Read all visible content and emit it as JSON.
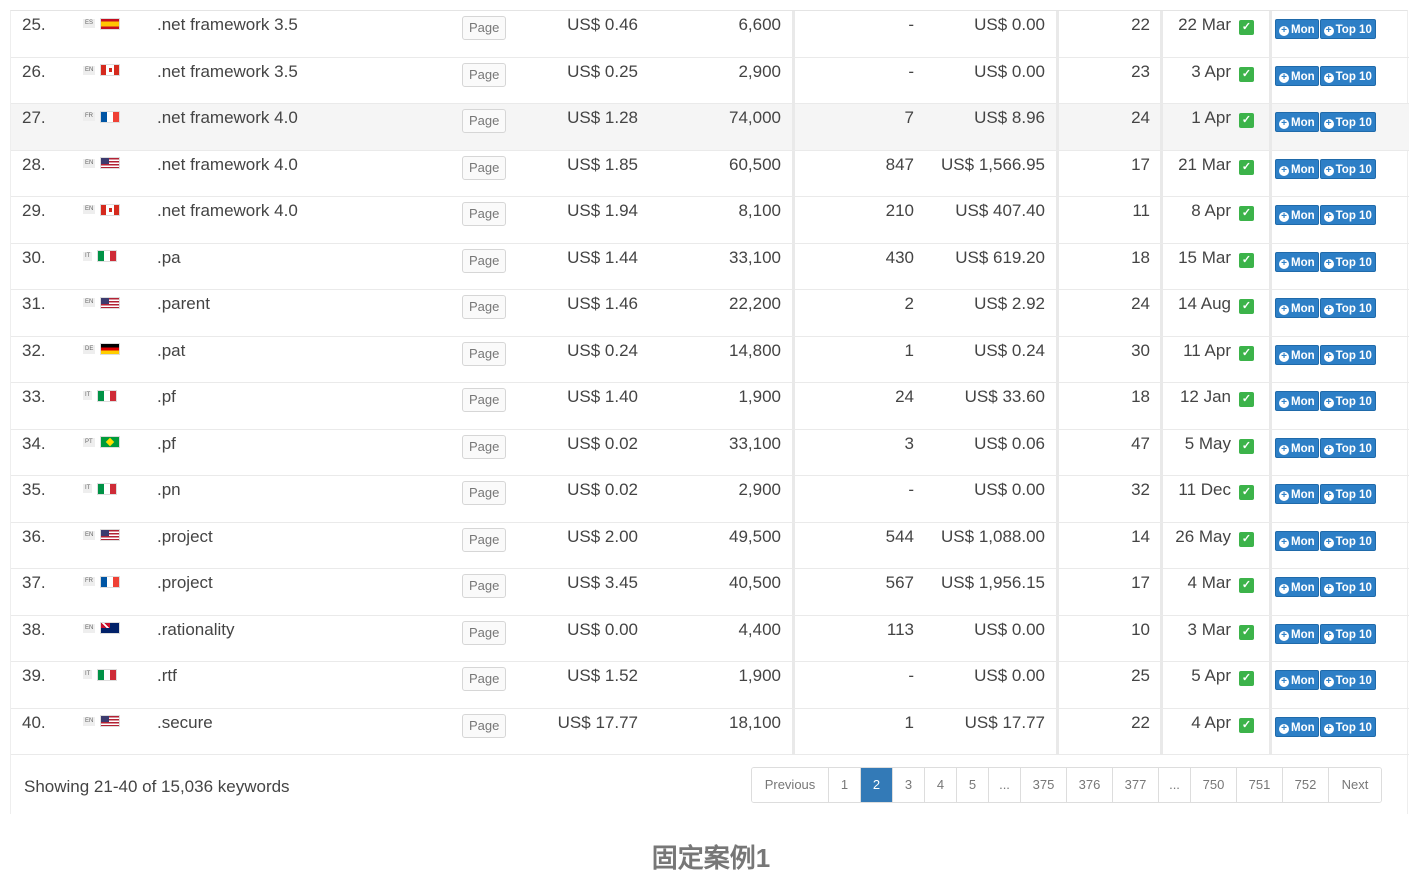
{
  "rows": [
    {
      "num": "25.",
      "lang": "ES",
      "flag": "es",
      "keyword": ".net framework 3.5",
      "type": "Page",
      "cpc": "US$ 0.46",
      "volume": "6,600",
      "clicks": "-",
      "value": "US$ 0.00",
      "comp": "22",
      "date": "22 Mar"
    },
    {
      "num": "26.",
      "lang": "EN",
      "flag": "ca",
      "keyword": ".net framework 3.5",
      "type": "Page",
      "cpc": "US$ 0.25",
      "volume": "2,900",
      "clicks": "-",
      "value": "US$ 0.00",
      "comp": "23",
      "date": "3 Apr"
    },
    {
      "num": "27.",
      "lang": "FR",
      "flag": "fr",
      "keyword": ".net framework 4.0",
      "type": "Page",
      "cpc": "US$ 1.28",
      "volume": "74,000",
      "clicks": "7",
      "value": "US$ 8.96",
      "comp": "24",
      "date": "1 Apr"
    },
    {
      "num": "28.",
      "lang": "EN",
      "flag": "us",
      "keyword": ".net framework 4.0",
      "type": "Page",
      "cpc": "US$ 1.85",
      "volume": "60,500",
      "clicks": "847",
      "value": "US$ 1,566.95",
      "comp": "17",
      "date": "21 Mar"
    },
    {
      "num": "29.",
      "lang": "EN",
      "flag": "ca",
      "keyword": ".net framework 4.0",
      "type": "Page",
      "cpc": "US$ 1.94",
      "volume": "8,100",
      "clicks": "210",
      "value": "US$ 407.40",
      "comp": "11",
      "date": "8 Apr"
    },
    {
      "num": "30.",
      "lang": "IT",
      "flag": "it",
      "keyword": ".pa",
      "type": "Page",
      "cpc": "US$ 1.44",
      "volume": "33,100",
      "clicks": "430",
      "value": "US$ 619.20",
      "comp": "18",
      "date": "15 Mar"
    },
    {
      "num": "31.",
      "lang": "EN",
      "flag": "us",
      "keyword": ".parent",
      "type": "Page",
      "cpc": "US$ 1.46",
      "volume": "22,200",
      "clicks": "2",
      "value": "US$ 2.92",
      "comp": "24",
      "date": "14 Aug"
    },
    {
      "num": "32.",
      "lang": "DE",
      "flag": "de",
      "keyword": ".pat",
      "type": "Page",
      "cpc": "US$ 0.24",
      "volume": "14,800",
      "clicks": "1",
      "value": "US$ 0.24",
      "comp": "30",
      "date": "11 Apr"
    },
    {
      "num": "33.",
      "lang": "IT",
      "flag": "it",
      "keyword": ".pf",
      "type": "Page",
      "cpc": "US$ 1.40",
      "volume": "1,900",
      "clicks": "24",
      "value": "US$ 33.60",
      "comp": "18",
      "date": "12 Jan"
    },
    {
      "num": "34.",
      "lang": "PT",
      "flag": "br",
      "keyword": ".pf",
      "type": "Page",
      "cpc": "US$ 0.02",
      "volume": "33,100",
      "clicks": "3",
      "value": "US$ 0.06",
      "comp": "47",
      "date": "5 May"
    },
    {
      "num": "35.",
      "lang": "IT",
      "flag": "it",
      "keyword": ".pn",
      "type": "Page",
      "cpc": "US$ 0.02",
      "volume": "2,900",
      "clicks": "-",
      "value": "US$ 0.00",
      "comp": "32",
      "date": "11 Dec"
    },
    {
      "num": "36.",
      "lang": "EN",
      "flag": "us",
      "keyword": ".project",
      "type": "Page",
      "cpc": "US$ 2.00",
      "volume": "49,500",
      "clicks": "544",
      "value": "US$ 1,088.00",
      "comp": "14",
      "date": "26 May"
    },
    {
      "num": "37.",
      "lang": "FR",
      "flag": "fr",
      "keyword": ".project",
      "type": "Page",
      "cpc": "US$ 3.45",
      "volume": "40,500",
      "clicks": "567",
      "value": "US$ 1,956.15",
      "comp": "17",
      "date": "4 Mar"
    },
    {
      "num": "38.",
      "lang": "EN",
      "flag": "au",
      "keyword": ".rationality",
      "type": "Page",
      "cpc": "US$ 0.00",
      "volume": "4,400",
      "clicks": "113",
      "value": "US$ 0.00",
      "comp": "10",
      "date": "3 Mar"
    },
    {
      "num": "39.",
      "lang": "IT",
      "flag": "it",
      "keyword": ".rtf",
      "type": "Page",
      "cpc": "US$ 1.52",
      "volume": "1,900",
      "clicks": "-",
      "value": "US$ 0.00",
      "comp": "25",
      "date": "5 Apr"
    },
    {
      "num": "40.",
      "lang": "EN",
      "flag": "us",
      "keyword": ".secure",
      "type": "Page",
      "cpc": "US$ 17.77",
      "volume": "18,100",
      "clicks": "1",
      "value": "US$ 17.77",
      "comp": "22",
      "date": "4 Apr"
    }
  ],
  "highlight_row_index": 2,
  "buttons": {
    "mon_label": "Mon",
    "top10_label": "Top 10",
    "plus_glyph": "+",
    "check_glyph": "✓"
  },
  "footer": {
    "showing": "Showing 21-40 of 15,036 keywords"
  },
  "pagination": {
    "items": [
      "Previous",
      "1",
      "2",
      "3",
      "4",
      "5",
      "...",
      "375",
      "376",
      "377",
      "...",
      "750",
      "751",
      "752",
      "Next"
    ],
    "active": "2"
  },
  "caption": "固定案例1",
  "colors": {
    "accent": "#337ab7",
    "button": "#2d7fc6",
    "check": "#3cb34a"
  }
}
